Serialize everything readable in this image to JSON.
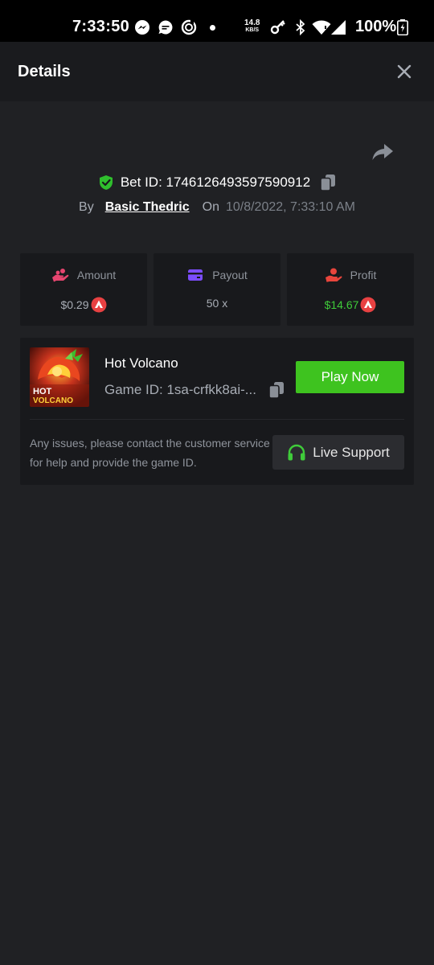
{
  "status_bar": {
    "time": "7:33:50",
    "net_speed_value": "14.8",
    "net_speed_unit": "KB/S",
    "battery": "100%",
    "icons": [
      "messenger-icon",
      "chat-icon",
      "app-icon",
      "dot-icon",
      "key-icon",
      "bluetooth-icon",
      "wifi-icon",
      "signal-icon",
      "battery-charging-icon"
    ]
  },
  "header": {
    "title": "Details",
    "close_icon": "close-icon"
  },
  "bet": {
    "id_text": "Bet ID: 1746126493597590912",
    "by_label": "By",
    "user": "Basic Thedric",
    "on_label": "On",
    "date": "10/8/2022, 7:33:10 AM"
  },
  "stats": {
    "amount": {
      "label": "Amount",
      "value": "$0.29",
      "icon": "hand-coins-icon"
    },
    "payout": {
      "label": "Payout",
      "value": "50 x",
      "icon": "card-icon"
    },
    "profit": {
      "label": "Profit",
      "value": "$14.67",
      "icon": "profit-hand-icon"
    }
  },
  "game": {
    "name": "Hot Volcano",
    "id_text": "Game ID: 1sa-crfkk8ai-...",
    "thumb_text_line1": "HOT",
    "thumb_text_line2": "VOLCANO",
    "play_label": "Play Now",
    "issue_text": "Any issues, please contact the customer service for help and provide the game ID.",
    "support_label": "Live Support"
  },
  "colors": {
    "background": "#202124",
    "header": "#1a1b1e",
    "card": "#18191c",
    "accent_green": "#3ec31f",
    "profit_green": "#3fcb3a",
    "coin_red": "#e84142",
    "amount_pink": "#e6456f",
    "payout_purple": "#7c4dff",
    "profit_red": "#e8453c"
  }
}
